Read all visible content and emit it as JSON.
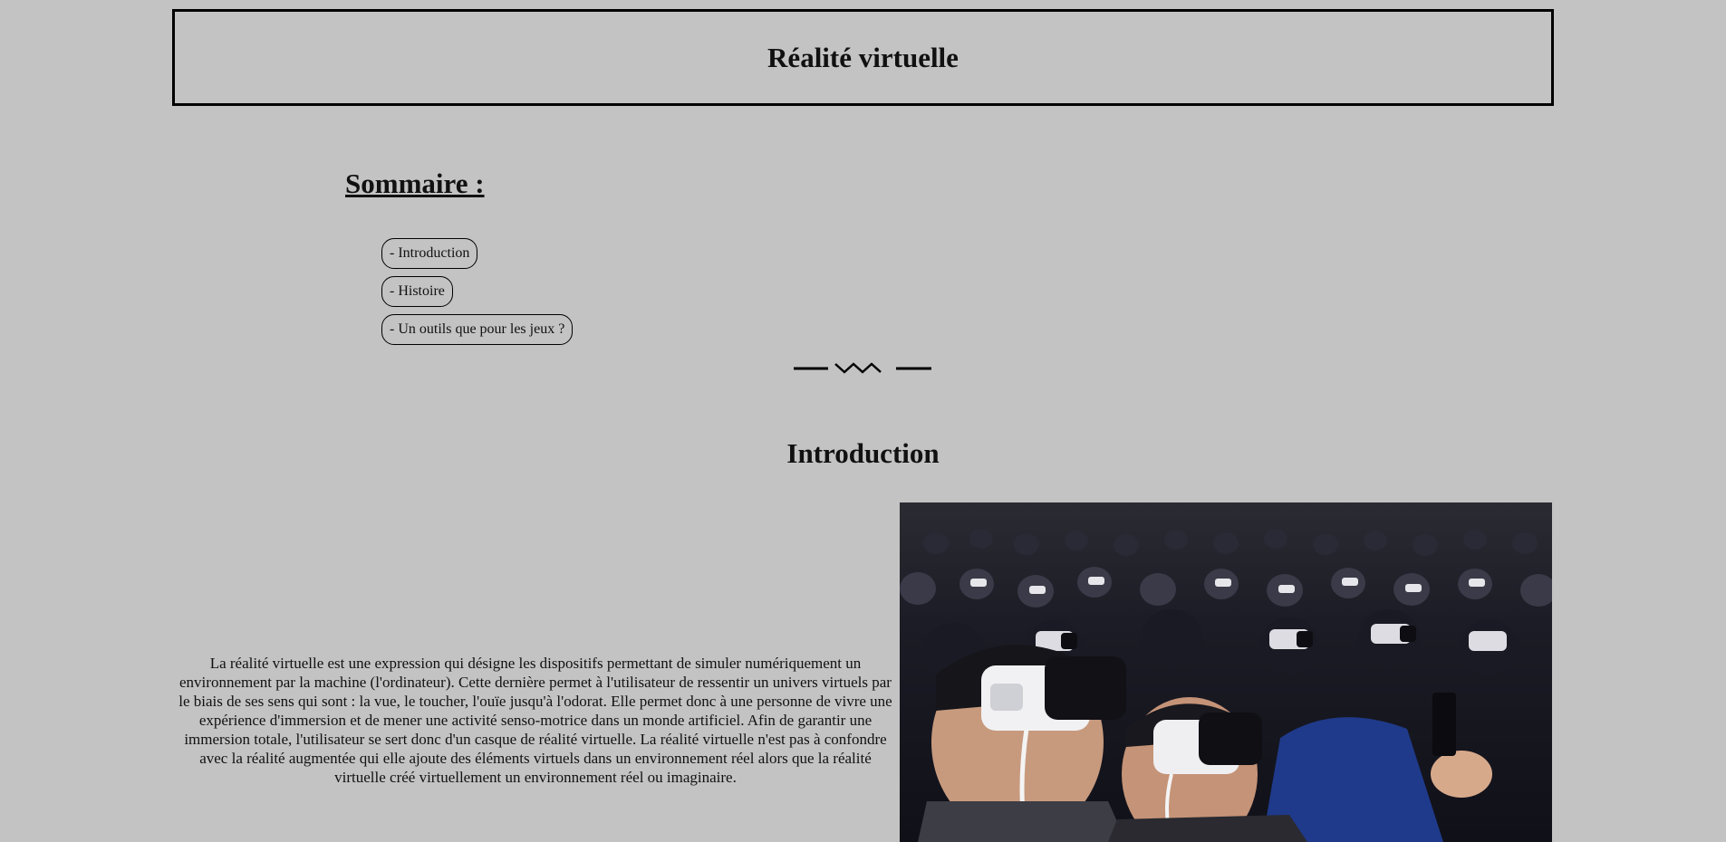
{
  "header": {
    "title": "Réalité virtuelle"
  },
  "sommaire": {
    "title": "Sommaire :",
    "items": [
      {
        "label": "- Introduction"
      },
      {
        "label": "- Histoire"
      },
      {
        "label": "- Un outils que pour les jeux ?"
      }
    ]
  },
  "introduction": {
    "title": "Introduction",
    "text": "La réalité virtuelle est une expression qui désigne les dispositifs permettant de simuler numériquement un environnement par la machine (l'ordinateur). Cette dernière permet à l'utilisateur de ressentir un univers virtuels par le biais de ses sens qui sont : la vue, le toucher, l'ouïe jusqu'à l'odorat. Elle permet donc à une personne de vivre une expérience d'immersion et de mener une activité senso-motrice dans un monde artificiel. Afin de garantir une immersion totale, l'utilisateur se sert donc d'un casque de réalité virtuelle. La réalité virtuelle n'est pas à confondre avec la réalité augmentée qui elle ajoute des éléments virtuels dans un environnement réel alors que la réalité virtuelle créé virtuellement un environnement réel ou imaginaire."
  },
  "colors": {
    "background": "#c3c3c3",
    "border": "#000000",
    "text": "#111111"
  },
  "icons": {
    "divider": "zigzag-divider-icon",
    "photo": "vr-audience-photo"
  }
}
